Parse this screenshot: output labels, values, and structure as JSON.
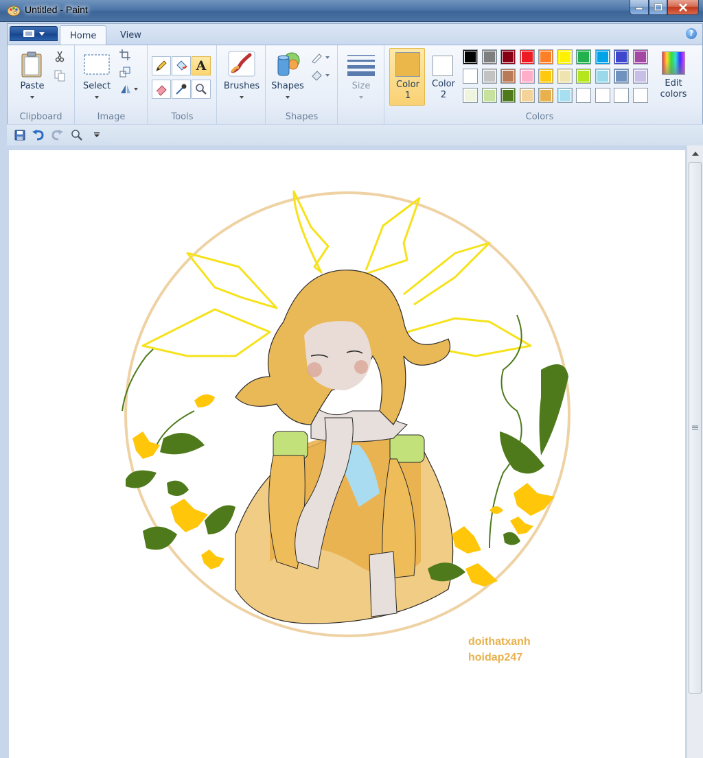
{
  "window": {
    "title": "Untitled - Paint"
  },
  "tabs": [
    {
      "label": "Home"
    },
    {
      "label": "View"
    }
  ],
  "ribbon": {
    "clipboard": {
      "group_label": "Clipboard",
      "paste_label": "Paste"
    },
    "image": {
      "group_label": "Image",
      "select_label": "Select"
    },
    "tools": {
      "group_label": "Tools"
    },
    "brushes": {
      "label": "Brushes"
    },
    "shapes": {
      "group_label": "Shapes",
      "shapes_label": "Shapes"
    },
    "size": {
      "label": "Size"
    },
    "colors": {
      "group_label": "Colors",
      "color1_label_a": "Color",
      "color1_label_b": "1",
      "color2_label_a": "Color",
      "color2_label_b": "2",
      "edit_label_a": "Edit",
      "edit_label_b": "colors",
      "color1": "#ebb64a",
      "color2": "#ffffff",
      "palette": [
        [
          "#000000",
          "#7f7f7f",
          "#880015",
          "#ed1c24",
          "#ff7f27",
          "#fff200",
          "#22b14c",
          "#00a2e8",
          "#3f48cc",
          "#a349a4"
        ],
        [
          "#ffffff",
          "#c3c3c3",
          "#b97a57",
          "#ffaec9",
          "#ffc90e",
          "#efe4b0",
          "#b5e61d",
          "#99d9ea",
          "#7092be",
          "#c8bfe7"
        ],
        [
          "#eef4de",
          "#c7e29d",
          "#4e7a1c",
          "#f3d39a",
          "#e8b14d",
          "#a8dff0",
          "#ffffff",
          "#ffffff",
          "#ffffff",
          "#ffffff"
        ]
      ]
    }
  },
  "quick_access": [
    "save-icon",
    "undo-icon",
    "redo-icon",
    "zoom-icon",
    "customize-icon"
  ],
  "canvas": {
    "signature_line1": "doithatxanh",
    "signature_line2": "hoidap247",
    "signature_color": "#e8b14d"
  }
}
